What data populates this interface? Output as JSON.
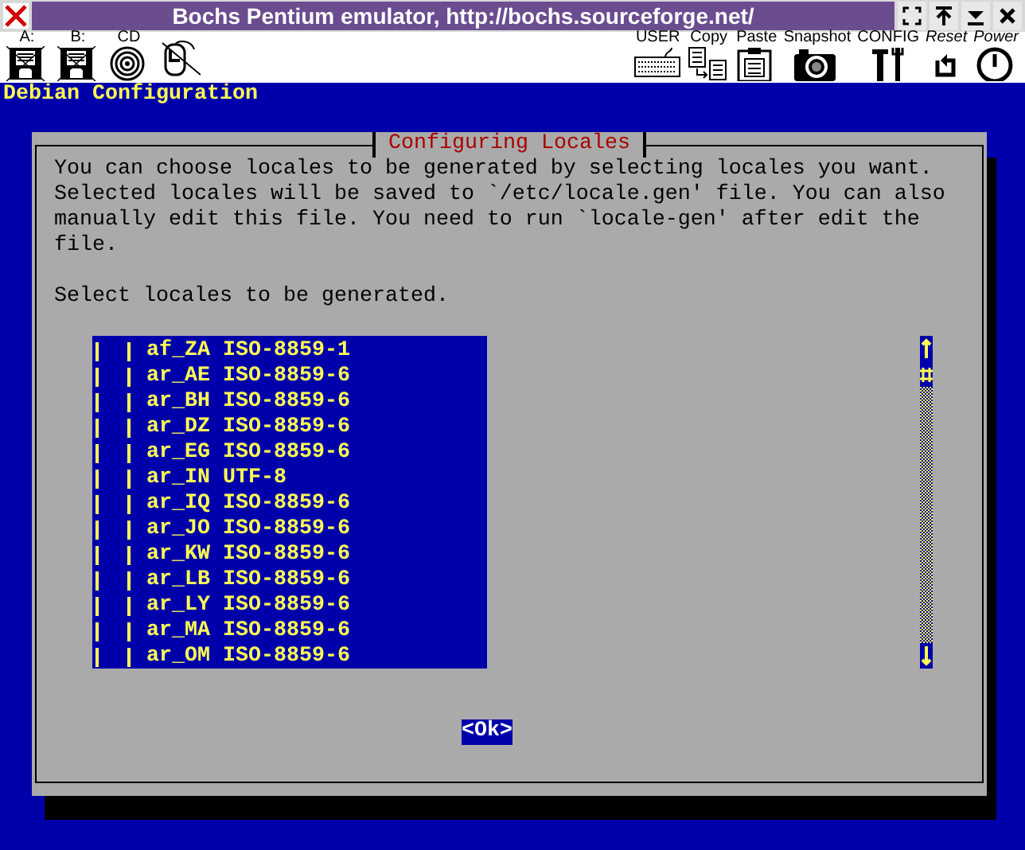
{
  "window": {
    "title": "Bochs Pentium emulator, http://bochs.sourceforge.net/"
  },
  "toolbar": {
    "left": [
      {
        "kind": "floppy",
        "label": "A:"
      },
      {
        "kind": "floppy",
        "label": "B:"
      },
      {
        "kind": "cdrom",
        "label": "CD"
      },
      {
        "kind": "mouse"
      }
    ],
    "right": [
      {
        "kind": "keyboard",
        "label": "USER"
      },
      {
        "kind": "copy",
        "label": "Copy"
      },
      {
        "kind": "paste",
        "label": "Paste"
      },
      {
        "kind": "camera",
        "label": "Snapshot"
      },
      {
        "kind": "config",
        "label": "CONFIG"
      },
      {
        "kind": "reset",
        "label": "Reset"
      },
      {
        "kind": "power",
        "label": "Power"
      }
    ]
  },
  "console": {
    "heading": "Debian Configuration"
  },
  "dialog": {
    "title": "Configuring Locales",
    "description": "You can choose locales to be generated by selecting locales you want. Selected locales will be saved to `/etc/locale.gen' file. You can also manually edit this file. You need to run `locale-gen' after edit the file.",
    "prompt": "Select locales to be generated.",
    "locales": [
      {
        "name": "af_ZA",
        "charset": "ISO-8859-1",
        "checked": false
      },
      {
        "name": "ar_AE",
        "charset": "ISO-8859-6",
        "checked": false
      },
      {
        "name": "ar_BH",
        "charset": "ISO-8859-6",
        "checked": false
      },
      {
        "name": "ar_DZ",
        "charset": "ISO-8859-6",
        "checked": false
      },
      {
        "name": "ar_EG",
        "charset": "ISO-8859-6",
        "checked": false
      },
      {
        "name": "ar_IN",
        "charset": "UTF-8",
        "checked": false
      },
      {
        "name": "ar_IQ",
        "charset": "ISO-8859-6",
        "checked": false
      },
      {
        "name": "ar_JO",
        "charset": "ISO-8859-6",
        "checked": false
      },
      {
        "name": "ar_KW",
        "charset": "ISO-8859-6",
        "checked": false
      },
      {
        "name": "ar_LB",
        "charset": "ISO-8859-6",
        "checked": false
      },
      {
        "name": "ar_LY",
        "charset": "ISO-8859-6",
        "checked": false
      },
      {
        "name": "ar_MA",
        "charset": "ISO-8859-6",
        "checked": false
      },
      {
        "name": "ar_OM",
        "charset": "ISO-8859-6",
        "checked": false
      }
    ],
    "buttons": [
      {
        "label": "<Ok>",
        "selected": true
      }
    ]
  }
}
